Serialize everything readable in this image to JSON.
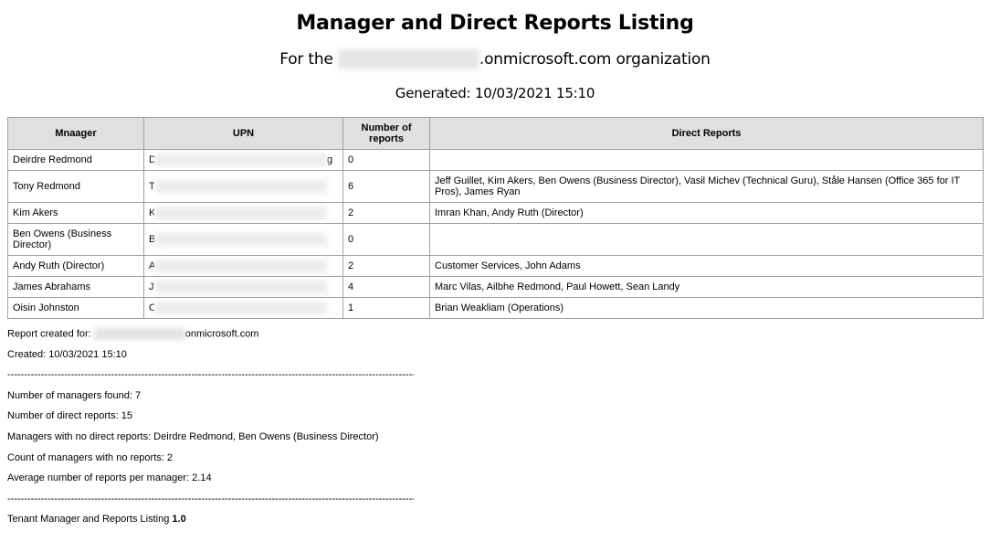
{
  "header": {
    "title": "Manager and Direct Reports Listing",
    "subtitle_prefix": "For the ",
    "subtitle_suffix": ".onmicrosoft.com organization",
    "generated": "Generated: 10/03/2021 15:10"
  },
  "table": {
    "columns": [
      "Mnaager",
      "UPN",
      "Number of reports",
      "Direct Reports"
    ],
    "rows": [
      {
        "manager": "Deirdre Redmond",
        "upn_initial": "D",
        "count": "0",
        "reports": ""
      },
      {
        "manager": "Tony Redmond",
        "upn_initial": "T",
        "count": "6",
        "reports": "Jeff Guillet, Kim Akers, Ben Owens (Business Director), Vasil Michev (Technical Guru), Ståle Hansen (Office 365 for IT Pros), James Ryan"
      },
      {
        "manager": "Kim Akers",
        "upn_initial": "K",
        "count": "2",
        "reports": "Imran Khan, Andy Ruth (Director)"
      },
      {
        "manager": "Ben Owens (Business Director)",
        "upn_initial": "B",
        "count": "0",
        "reports": ""
      },
      {
        "manager": "Andy Ruth (Director)",
        "upn_initial": "A",
        "count": "2",
        "reports": "Customer Services, John Adams"
      },
      {
        "manager": "James Abrahams",
        "upn_initial": "J",
        "count": "4",
        "reports": "Marc Vilas, Ailbhe Redmond, Paul Howett, Sean Landy"
      },
      {
        "manager": "Oisin Johnston",
        "upn_initial": "O",
        "count": "1",
        "reports": "Brian Weakliam (Operations)"
      }
    ]
  },
  "footer": {
    "report_created_for_label": "Report created for: ",
    "report_created_for_suffix": "onmicrosoft.com",
    "created": "Created: 10/03/2021 15:10",
    "divider": "------------------------------------------------------------------------------------------------------------------------------",
    "managers_found": "Number of managers found: 7",
    "direct_reports": "Number of direct reports: 15",
    "no_direct_reports": "Managers with no direct reports: Deirdre Redmond, Ben Owens (Business Director)",
    "count_no_reports": "Count of managers with no reports: 2",
    "average": "Average number of reports per manager: 2.14",
    "product_name": "Tenant Manager and Reports Listing ",
    "product_version": "1.0"
  }
}
